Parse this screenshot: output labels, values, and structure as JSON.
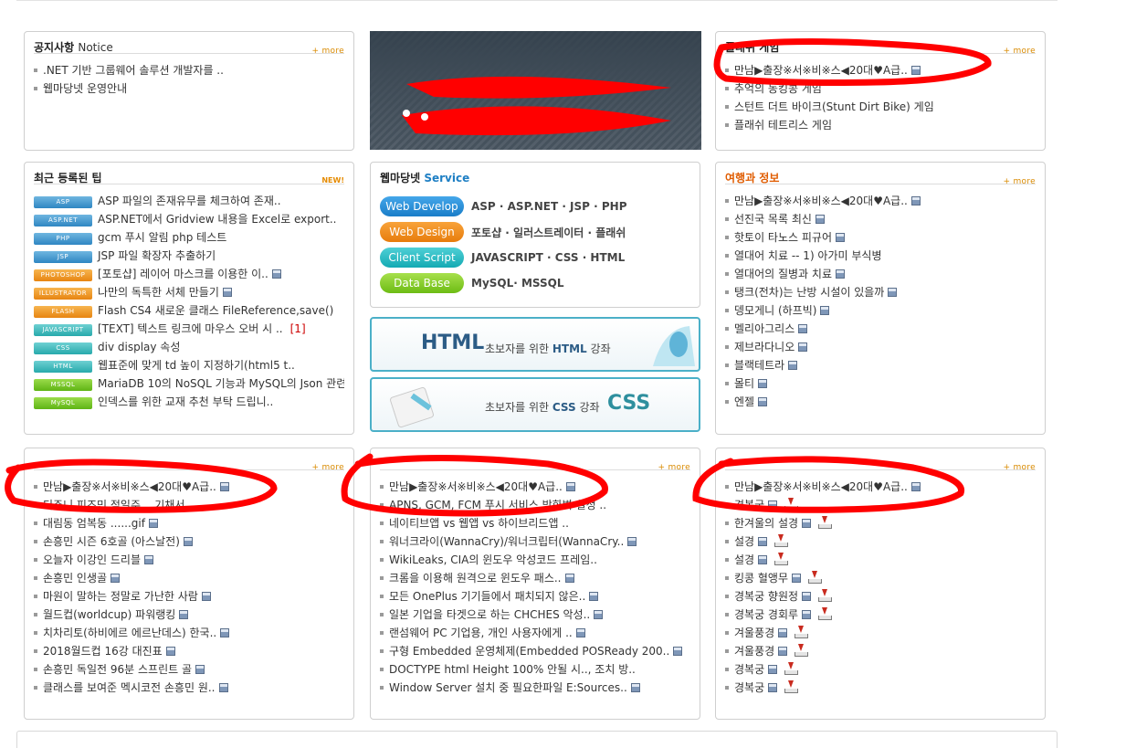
{
  "common": {
    "more_label": "+ more",
    "new_label": "NEW!"
  },
  "notice": {
    "title": "공지사항",
    "title_en": "Notice",
    "items": [
      ".NET 기반 그룹웨어 솔루션 개발자를 ..",
      "웹마당넷 운영안내"
    ]
  },
  "flash": {
    "title": "플래쉬 게임",
    "items": [
      "만남▶출장※서※비※스◀20대♥A급..",
      "추억의 동킹콩 게임",
      "스턴트 더트 바이크(Stunt Dirt Bike) 게임",
      "플래쉬 테트리스 게임"
    ]
  },
  "tips": {
    "title": "최근 등록된 팁",
    "items": [
      {
        "tag": "ASP",
        "text": "ASP 파일의 존재유무를 체크하여 존재.."
      },
      {
        "tag": "ASP.NET",
        "text": "ASP.NET에서 Gridview 내용을 Excel로 export.."
      },
      {
        "tag": "PHP",
        "text": "gcm 푸시 알림 php 테스트"
      },
      {
        "tag": "JSP",
        "text": "JSP 파일 확장자 추출하기"
      },
      {
        "tag": "PHOTOSHOP",
        "text": "[포토샵] 레이어 마스크를 이용한 이.."
      },
      {
        "tag": "ILLUSTRATOR",
        "text": "나만의 독특한 서체 만들기"
      },
      {
        "tag": "FLASH",
        "text": "Flash CS4 새로운 클래스 FileReference,save()"
      },
      {
        "tag": "JAVASCRIPT",
        "text": "[TEXT] 텍스트 링크에 마우스 오버 시 .."
      },
      {
        "tag": "CSS",
        "text": "div display 속성"
      },
      {
        "tag": "HTML",
        "text": "웹표준에 맞게 td 높이 지정하기(html5 t.."
      },
      {
        "tag": "MSSQL",
        "text": "MariaDB 10의 NoSQL 기능과 MySQL의 Json 관련"
      },
      {
        "tag": "MySQL",
        "text": "인덱스를 위한 교재 추천 부탁 드립니.."
      }
    ],
    "comment_count": "[1]"
  },
  "service": {
    "title": "웹마당넷",
    "title_en": "Service",
    "rows": [
      {
        "label": "Web Develop",
        "text": "ASP · ASP.NET · JSP · PHP"
      },
      {
        "label": "Web Design",
        "text": "포토샵 · 일러스트레이터 · 플래쉬"
      },
      {
        "label": "Client Script",
        "text": "JAVASCRIPT · CSS · HTML"
      },
      {
        "label": "Data Base",
        "text": "MySQL· MSSQL"
      }
    ]
  },
  "lecture_html": {
    "big": "HTML",
    "prefix": "초보자를 위한",
    "strong": "HTML",
    "suffix": "강좌"
  },
  "lecture_css": {
    "big": "CSS",
    "prefix": "초보자를 위한",
    "strong": "CSS",
    "suffix": "강좌"
  },
  "travel": {
    "title": "여행과 정보",
    "items": [
      "만남▶출장※서※비※스◀20대♥A급..",
      "선진국 목록 최신",
      "핫토이 타노스 피규어",
      "열대어 치료 -- 1) 아가미 부식병",
      "열대어의 질병과 치료",
      "탱크(전차)는 난방 시설이 있을까",
      "뎅모게니 (하프빅)",
      "멜리아그리스",
      "제브라다니오",
      "블랙테트라",
      "몰티",
      "엔젤"
    ]
  },
  "col1": {
    "items": [
      "만남▶출장※서※비※스◀20대♥A급..",
      "디주니 피즈민 점일주 .. 기채서..",
      "대림동 엄복동 ......gif",
      "손흥민 시즌 6호골 (아스날전)",
      "오늘자 이강인 드리블",
      "손흥민 인생골",
      "마원이 말하는 정말로 가난한 사람",
      "월드컵(worldcup) 파워랭킹",
      "치차리토(하비에르 에르난데스) 한국..",
      "2018월드컵 16강 대진표",
      "손흥민 독일전 96분 스프린트 골",
      "클래스를 보여준 멕시코전 손흥민 원.."
    ]
  },
  "col2": {
    "items": [
      "만남▶출장※서※비※스◀20대♥A급..",
      "APNS, GCM, FCM 푸시 서비스 방화벽 설정 ..",
      "네이티브앱 vs 웹앱 vs 하이브리드앱 ..",
      "워너크라이(WannaCry)/워너크립터(WannaCry..",
      "WikiLeaks, CIA의 윈도우 악성코드 프레임..",
      "크롬을 이용해 원격으로 윈도우 패스..",
      "모든 OnePlus 기기들에서 패치되지 않은..",
      "일본 기업을 타겟으로 하는 CHCHES 악성..",
      "랜섬웨어 PC 기업용, 개인 사용자에게 ..",
      "구형 Embedded 운영체제(Embedded POSReady 200..",
      "DOCTYPE html Height 100% 안될 시.., 조치 방..",
      "Window Server 설치 중 필요한파일 E:Sources.."
    ]
  },
  "col3": {
    "items": [
      "만남▶출장※서※비※스◀20대♥A급..",
      "경복궁",
      "한겨울의 설경",
      "설경",
      "설경",
      "킹콩 혈앵무",
      "경복궁 향원정",
      "경복궁 경회루",
      "겨울풍경",
      "겨울풍경",
      "경복궁",
      "경복궁"
    ]
  },
  "colors": {
    "scribble": "#ff0000",
    "accent": "#e05c00",
    "more": "#d98a00"
  }
}
